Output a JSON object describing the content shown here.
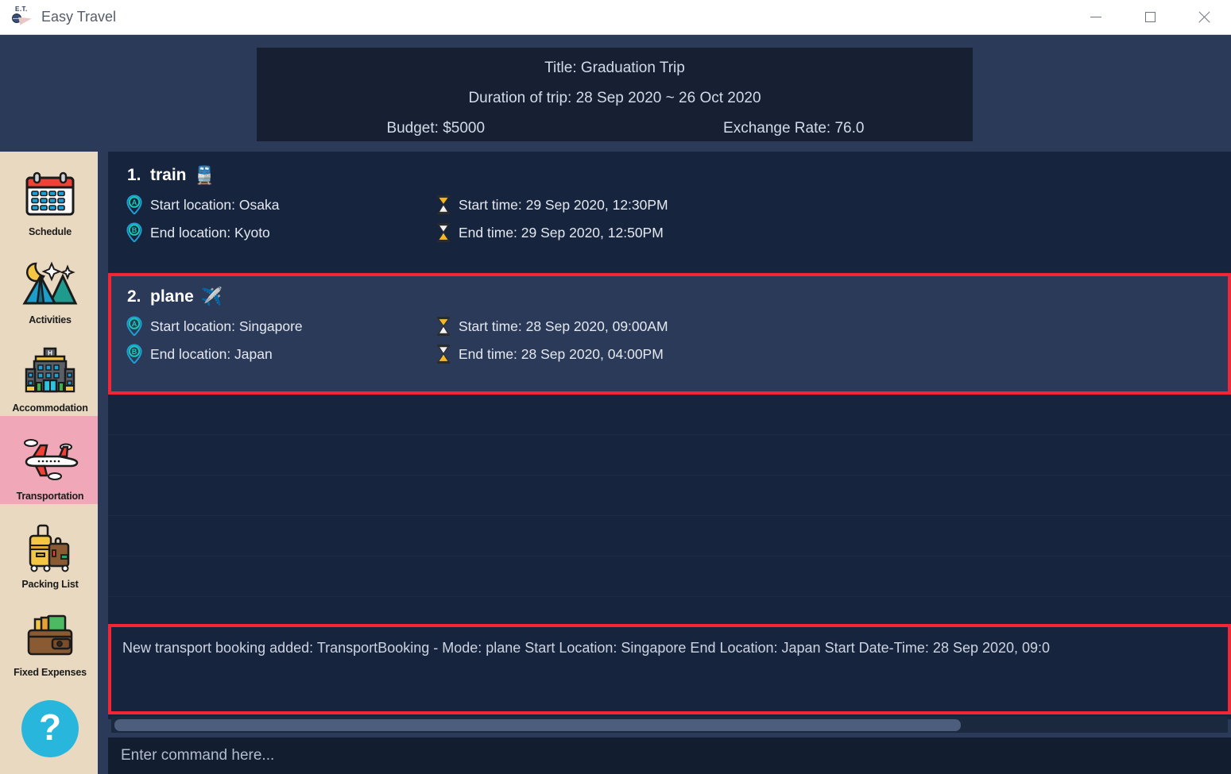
{
  "window": {
    "title": "Easy Travel",
    "logo_text": "E.T.",
    "minimize_label": "Minimize",
    "maximize_label": "Maximize",
    "close_label": "Close"
  },
  "trip": {
    "title_line": "Title: Graduation Trip",
    "duration_line": "Duration of trip: 28 Sep 2020 ~ 26 Oct 2020",
    "budget": "Budget: $5000",
    "exchange_rate": "Exchange Rate: 76.0"
  },
  "sidebar": {
    "items": [
      {
        "label": "Schedule",
        "icon": "calendar-icon",
        "active": false
      },
      {
        "label": "Activities",
        "icon": "tent-icon",
        "active": false
      },
      {
        "label": "Accommodation",
        "icon": "hotel-icon",
        "active": false
      },
      {
        "label": "Transportation",
        "icon": "airplane-icon",
        "active": true
      },
      {
        "label": "Packing List",
        "icon": "luggage-icon",
        "active": false
      },
      {
        "label": "Fixed Expenses",
        "icon": "wallet-icon",
        "active": false
      }
    ],
    "help_label": "?"
  },
  "bookings": [
    {
      "num": "1.",
      "mode": "train",
      "emoji": "🚆",
      "start_location": "Start location: Osaka",
      "end_location": "End location: Kyoto",
      "start_time": "Start time: 29 Sep 2020, 12:30PM",
      "end_time": "End time: 29 Sep 2020, 12:50PM",
      "highlighted": false
    },
    {
      "num": "2.",
      "mode": "plane",
      "emoji": "✈️",
      "start_location": "Start location: Singapore",
      "end_location": "End location: Japan",
      "start_time": "Start time: 28 Sep 2020, 09:00AM",
      "end_time": "End time: 28 Sep 2020, 04:00PM",
      "highlighted": true
    }
  ],
  "log": {
    "message": "New transport booking added: TransportBooking - Mode: plane Start Location: Singapore End Location: Japan Start Date-Time: 28 Sep 2020, 09:0"
  },
  "command": {
    "placeholder": "Enter command here...",
    "value": ""
  },
  "colors": {
    "app_background": "#2b3a58",
    "panel_background": "#17243d",
    "header_background": "#171f33",
    "sidebar_background": "#e8d9c0",
    "sidebar_active": "#f0a8b8",
    "highlight_border": "#f42534",
    "help_button": "#29b6dd",
    "scrollbar_thumb": "#4d5d7c"
  }
}
